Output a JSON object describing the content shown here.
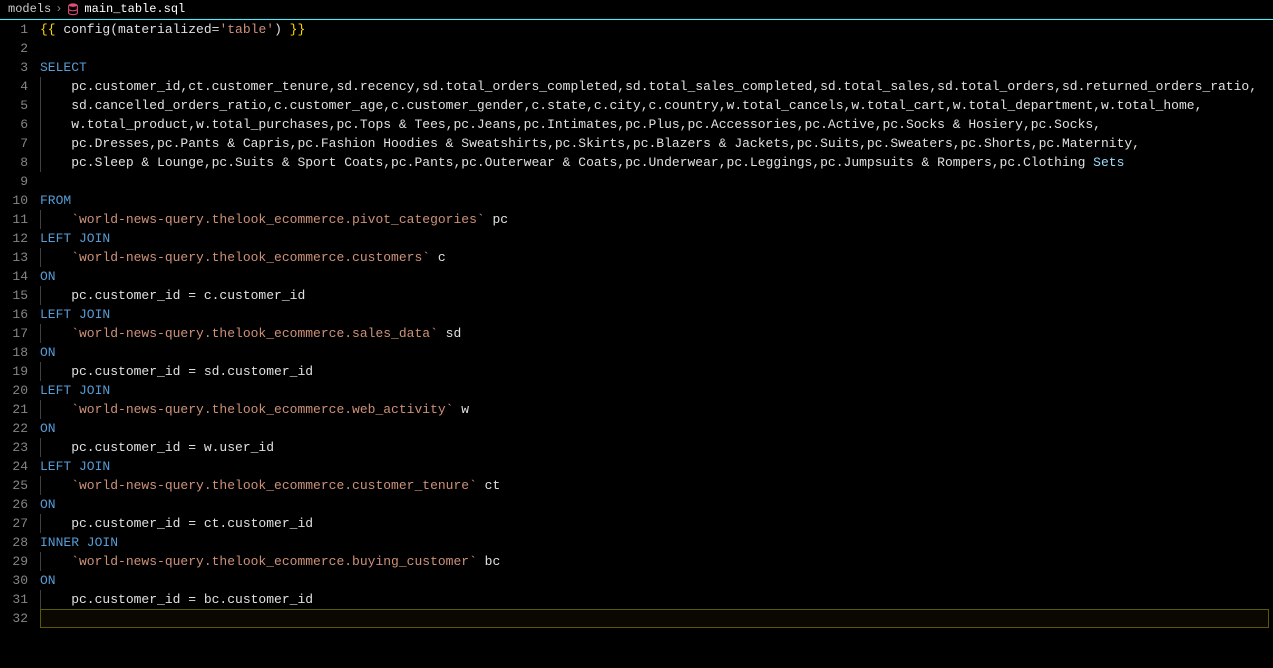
{
  "breadcrumb": {
    "folder": "models",
    "separator": "›",
    "filename": "main_table.sql"
  },
  "editor": {
    "currentLine": 32,
    "lines": [
      {
        "n": 1,
        "indent": 0,
        "tokens": [
          {
            "t": "{{ ",
            "c": "brace"
          },
          {
            "t": "config(materialized",
            "c": "default"
          },
          {
            "t": "=",
            "c": "eq"
          },
          {
            "t": "'table'",
            "c": "string"
          },
          {
            "t": ") ",
            "c": "default"
          },
          {
            "t": "}}",
            "c": "brace"
          }
        ]
      },
      {
        "n": 2,
        "indent": 0,
        "tokens": []
      },
      {
        "n": 3,
        "indent": 0,
        "tokens": [
          {
            "t": "SELECT",
            "c": "keyword"
          }
        ]
      },
      {
        "n": 4,
        "indent": 1,
        "tokens": [
          {
            "t": "    pc.customer_id,ct.customer_tenure,sd.recency,sd.total_orders_completed,sd.total_sales_completed,sd.total_sales,sd.total_orders,sd.returned_orders_ratio,",
            "c": "default"
          }
        ]
      },
      {
        "n": 5,
        "indent": 1,
        "tokens": [
          {
            "t": "    sd.cancelled_orders_ratio,c.customer_age,c.customer_gender,c.state,c.city,c.country,w.total_cancels,w.total_cart,w.total_department,w.total_home,",
            "c": "default"
          }
        ]
      },
      {
        "n": 6,
        "indent": 1,
        "tokens": [
          {
            "t": "    w.total_product,w.total_purchases,pc.Tops & Tees,pc.Jeans,pc.Intimates,pc.Plus,pc.Accessories,pc.Active,pc.Socks & Hosiery,pc.Socks,",
            "c": "default"
          }
        ]
      },
      {
        "n": 7,
        "indent": 1,
        "tokens": [
          {
            "t": "    pc.Dresses,pc.Pants & Capris,pc.Fashion Hoodies & Sweatshirts,pc.Skirts,pc.Blazers & Jackets,pc.Suits,pc.Sweaters,pc.Shorts,pc.Maternity,",
            "c": "default"
          }
        ]
      },
      {
        "n": 8,
        "indent": 1,
        "tokens": [
          {
            "t": "    pc.Sleep & Lounge,pc.Suits & Sport Coats,pc.Pants,pc.Outerwear & Coats,pc.Underwear,pc.Leggings,pc.Jumpsuits & Rompers,pc.Clothing ",
            "c": "default"
          },
          {
            "t": "Sets",
            "c": "special"
          }
        ]
      },
      {
        "n": 9,
        "indent": 0,
        "tokens": []
      },
      {
        "n": 10,
        "indent": 0,
        "tokens": [
          {
            "t": "FROM",
            "c": "keyword"
          }
        ]
      },
      {
        "n": 11,
        "indent": 1,
        "tokens": [
          {
            "t": "    `world-news-query.thelook_ecommerce.pivot_categories`",
            "c": "string"
          },
          {
            "t": " pc",
            "c": "default"
          }
        ]
      },
      {
        "n": 12,
        "indent": 0,
        "tokens": [
          {
            "t": "LEFT JOIN",
            "c": "keyword"
          }
        ]
      },
      {
        "n": 13,
        "indent": 1,
        "tokens": [
          {
            "t": "    `world-news-query.thelook_ecommerce.customers`",
            "c": "string"
          },
          {
            "t": " c",
            "c": "default"
          }
        ]
      },
      {
        "n": 14,
        "indent": 0,
        "tokens": [
          {
            "t": "ON",
            "c": "keyword"
          }
        ]
      },
      {
        "n": 15,
        "indent": 1,
        "tokens": [
          {
            "t": "    pc.customer_id = c.customer_id",
            "c": "default"
          }
        ]
      },
      {
        "n": 16,
        "indent": 0,
        "tokens": [
          {
            "t": "LEFT JOIN",
            "c": "keyword"
          }
        ]
      },
      {
        "n": 17,
        "indent": 1,
        "tokens": [
          {
            "t": "    `world-news-query.thelook_ecommerce.sales_data`",
            "c": "string"
          },
          {
            "t": " sd",
            "c": "default"
          }
        ]
      },
      {
        "n": 18,
        "indent": 0,
        "tokens": [
          {
            "t": "ON",
            "c": "keyword"
          }
        ]
      },
      {
        "n": 19,
        "indent": 1,
        "tokens": [
          {
            "t": "    pc.customer_id = sd.customer_id",
            "c": "default"
          }
        ]
      },
      {
        "n": 20,
        "indent": 0,
        "tokens": [
          {
            "t": "LEFT JOIN",
            "c": "keyword"
          }
        ]
      },
      {
        "n": 21,
        "indent": 1,
        "tokens": [
          {
            "t": "    `world-news-query.thelook_ecommerce.web_activity`",
            "c": "string"
          },
          {
            "t": " w",
            "c": "default"
          }
        ]
      },
      {
        "n": 22,
        "indent": 0,
        "tokens": [
          {
            "t": "ON",
            "c": "keyword"
          }
        ]
      },
      {
        "n": 23,
        "indent": 1,
        "tokens": [
          {
            "t": "    pc.customer_id = w.user_id",
            "c": "default"
          }
        ]
      },
      {
        "n": 24,
        "indent": 0,
        "tokens": [
          {
            "t": "LEFT JOIN",
            "c": "keyword"
          }
        ]
      },
      {
        "n": 25,
        "indent": 1,
        "tokens": [
          {
            "t": "    `world-news-query.thelook_ecommerce.customer_tenure`",
            "c": "string"
          },
          {
            "t": " ct",
            "c": "default"
          }
        ]
      },
      {
        "n": 26,
        "indent": 0,
        "tokens": [
          {
            "t": "ON",
            "c": "keyword"
          }
        ]
      },
      {
        "n": 27,
        "indent": 1,
        "tokens": [
          {
            "t": "    pc.customer_id = ct.customer_id",
            "c": "default"
          }
        ]
      },
      {
        "n": 28,
        "indent": 0,
        "tokens": [
          {
            "t": "INNER JOIN",
            "c": "keyword"
          }
        ]
      },
      {
        "n": 29,
        "indent": 1,
        "tokens": [
          {
            "t": "    `world-news-query.thelook_ecommerce.buying_customer`",
            "c": "string"
          },
          {
            "t": " bc",
            "c": "default"
          }
        ]
      },
      {
        "n": 30,
        "indent": 0,
        "tokens": [
          {
            "t": "ON",
            "c": "keyword"
          }
        ]
      },
      {
        "n": 31,
        "indent": 1,
        "tokens": [
          {
            "t": "    pc.customer_id = bc.customer_id",
            "c": "default"
          }
        ]
      },
      {
        "n": 32,
        "indent": 0,
        "tokens": []
      }
    ]
  }
}
